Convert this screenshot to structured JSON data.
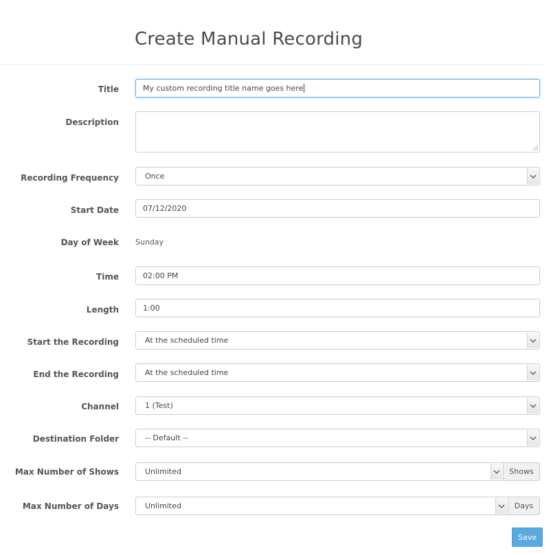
{
  "page": {
    "title": "Create Manual Recording"
  },
  "form": {
    "title": {
      "label": "Title",
      "value": "My custom recording title name goes here"
    },
    "description": {
      "label": "Description",
      "value": ""
    },
    "recording_frequency": {
      "label": "Recording Frequency",
      "value": "Once"
    },
    "start_date": {
      "label": "Start Date",
      "value": "07/12/2020"
    },
    "day_of_week": {
      "label": "Day of Week",
      "value": "Sunday"
    },
    "time": {
      "label": "Time",
      "value": "02:00 PM"
    },
    "length": {
      "label": "Length",
      "value": "1:00"
    },
    "start_recording": {
      "label": "Start the Recording",
      "value": "At the scheduled time"
    },
    "end_recording": {
      "label": "End the Recording",
      "value": "At the scheduled time"
    },
    "channel": {
      "label": "Channel",
      "value": "1 (Test)"
    },
    "destination_folder": {
      "label": "Destination Folder",
      "value": "-- Default --"
    },
    "max_shows": {
      "label": "Max Number of Shows",
      "value": "Unlimited",
      "addon": "Shows"
    },
    "max_days": {
      "label": "Max Number of Days",
      "value": "Unlimited",
      "addon": "Days"
    }
  },
  "actions": {
    "save_label": "Save"
  },
  "colors": {
    "save_button": "#5aa9e0",
    "focus_border": "#66afe9"
  },
  "icons": {
    "select_arrow": "chevron-down-icon",
    "textarea_grip": "resize-grip-icon"
  }
}
